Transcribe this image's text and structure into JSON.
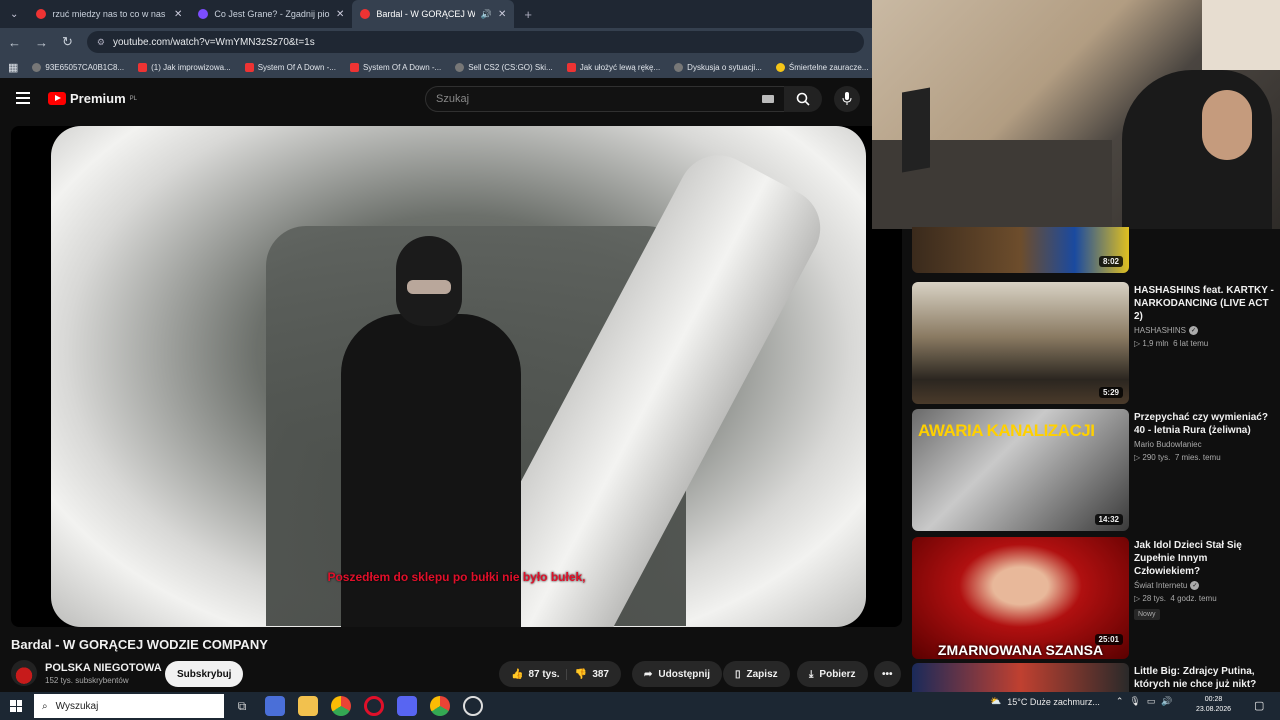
{
  "browser": {
    "tabs": [
      {
        "title": "rzuć miedzy nas to co w nas zło",
        "active": false
      },
      {
        "title": "Co Jest Grane? - Zgadnij piosen",
        "active": false
      },
      {
        "title": "Bardal - W GORĄCEJ WODZ",
        "active": true
      }
    ],
    "url": "youtube.com/watch?v=WmYMN3zSz70&t=1s",
    "bookmarks": [
      "93E65057CA0B1C8...",
      "(1) Jak improwizowa...",
      "System Of A Down -...",
      "System Of A Down -...",
      "Sell CS2 (CS:GO) Ski...",
      "Jak ułożyć lewą rękę...",
      "Dyskusja o sytuacji...",
      "Śmiertelne zauracze..."
    ]
  },
  "youtube": {
    "logo_text": "Premium",
    "logo_region": "PL",
    "search_placeholder": "Szukaj",
    "subtitle": "Poszedłem do sklepu po bułki nie było bułek,",
    "video_title": "Bardal - W GORĄCEJ WODZIE COMPANY",
    "channel": {
      "name": "POLSKA NIEGOTOWA",
      "subs": "152 tys. subskrybentów"
    },
    "subscribe_label": "Subskrybuj",
    "actions": {
      "likes": "87 tys.",
      "dislikes": "387",
      "share": "Udostępnij",
      "save": "Zapisz",
      "download": "Pobierz"
    }
  },
  "recommendations": [
    {
      "title": "",
      "channel": "",
      "meta": "",
      "duration": "8:02"
    },
    {
      "title": "HASHASHINS feat. KARTKY - NARKODANCING (LIVE ACT 2)",
      "channel": "HASHASHINS",
      "views": "1,9 mln",
      "age": "6 lat temu",
      "duration": "5:29"
    },
    {
      "title": "Przepychać czy wymieniać? 40 - letnia Rura (żeliwna)",
      "channel": "Mario Budowlaniec",
      "views": "290 tys.",
      "age": "7 mies. temu",
      "duration": "14:32",
      "thumb_text": "AWARIA KANALIZACJI"
    },
    {
      "title": "Jak Idol Dzieci Stał Się Zupełnie Innym Człowiekiem?",
      "channel": "Świat Internetu",
      "views": "28 tys.",
      "age": "4 godz. temu",
      "badge": "Nowy",
      "duration": "25:01",
      "thumb_text": "ZMARNOWANA SZANSA"
    },
    {
      "title": "Little Big: Zdrajcy Putina, których nie chce już nikt?",
      "channel": "",
      "views": "",
      "age": "",
      "duration": ""
    }
  ],
  "taskbar": {
    "search": "Wyszukaj",
    "weather": "15°C  Duże zachmurz...",
    "time": "00:28",
    "date": "23.08.2026"
  },
  "colors": {
    "accent": "#ff0000",
    "bg": "#0f0f0f",
    "subtitle": "#e0102a"
  }
}
